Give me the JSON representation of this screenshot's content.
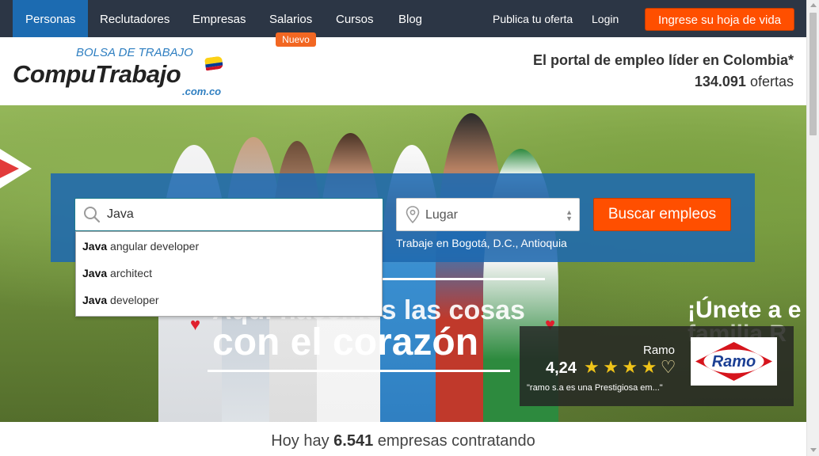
{
  "nav": {
    "items": [
      {
        "label": "Personas",
        "active": true
      },
      {
        "label": "Reclutadores"
      },
      {
        "label": "Empresas"
      },
      {
        "label": "Salarios"
      },
      {
        "label": "Cursos"
      },
      {
        "label": "Blog"
      }
    ],
    "badge_new": "Nuevo",
    "publish_label": "Publica tu oferta",
    "login_label": "Login",
    "cv_button": "Ingrese su hoja de vida"
  },
  "header": {
    "logo_sub": "BOLSA DE TRABAJO",
    "logo_main": "CompuTrabajo",
    "logo_domain": ".com.co",
    "tagline": "El portal de empleo líder en Colombia*",
    "offers_count": "134.091",
    "offers_label": "ofertas"
  },
  "search": {
    "query": "Java",
    "location_placeholder": "Lugar",
    "button_label": "Buscar empleos",
    "location_hint": "Trabaje en Bogotá, D.C., Antioquia",
    "suggestions": [
      {
        "bold": "Java",
        "rest": " angular developer"
      },
      {
        "bold": "Java",
        "rest": " architect"
      },
      {
        "bold": "Java",
        "rest": " developer"
      }
    ]
  },
  "hero": {
    "slogan_line1": "Aquí hacemos las cosas",
    "slogan_line2": "con el corazón",
    "join_line1": "¡Únete a e",
    "join_line2": "familia R"
  },
  "company_card": {
    "name": "Ramo",
    "rating": "4,24",
    "stars_full": 4,
    "review": "\"ramo s.a es una Prestigiosa em...\"",
    "logo_text": "Ramo"
  },
  "stats": {
    "prefix": "Hoy hay",
    "count": "6.541",
    "suffix": "empresas contratando"
  },
  "colors": {
    "nav_bg": "#2c3645",
    "nav_active": "#1c6bb1",
    "accent_orange": "#ff4f00",
    "brand_blue": "#2f7fc1",
    "star": "#f0c419"
  }
}
